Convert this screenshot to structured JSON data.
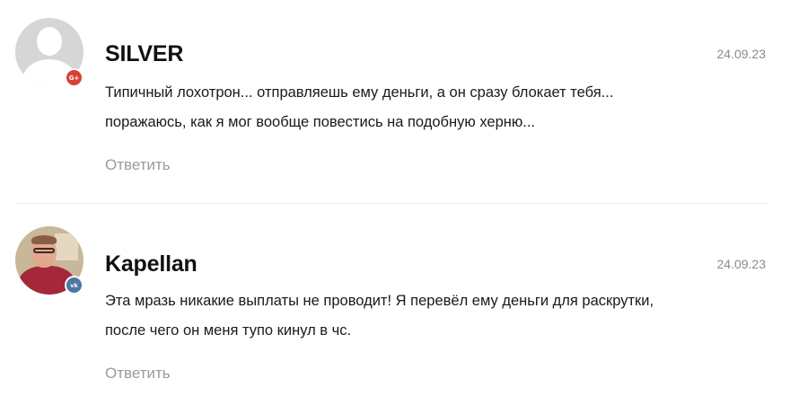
{
  "comments": [
    {
      "author": "SILVER",
      "date": "24.09.23",
      "text_lines": [
        "Типичный лохотрон... отправляешь ему деньги, а он сразу блокает тебя...",
        "поражаюсь, как я мог вообще повестись на подобную херню..."
      ],
      "reply_label": "Ответить",
      "avatar": "default-user-avatar",
      "badge": {
        "icon": "google-plus-icon",
        "text": "G+",
        "color": "#d93f36"
      }
    },
    {
      "author": "Kapellan",
      "date": "24.09.23",
      "text_lines": [
        "Эта мразь никакие выплаты не проводит! Я перевёл ему деньги для раскрутки,",
        "после чего он меня тупо кинул в чс."
      ],
      "reply_label": "Ответить",
      "avatar": "user-photo-avatar",
      "badge": {
        "icon": "vk-icon",
        "text": "vk",
        "color": "#4d76a1"
      }
    }
  ],
  "colors": {
    "author_text": "#111111",
    "body_text": "#1a1a1a",
    "muted_text": "#8a8a8a",
    "reply_text": "#9a9a9a",
    "divider": "#ededed"
  }
}
